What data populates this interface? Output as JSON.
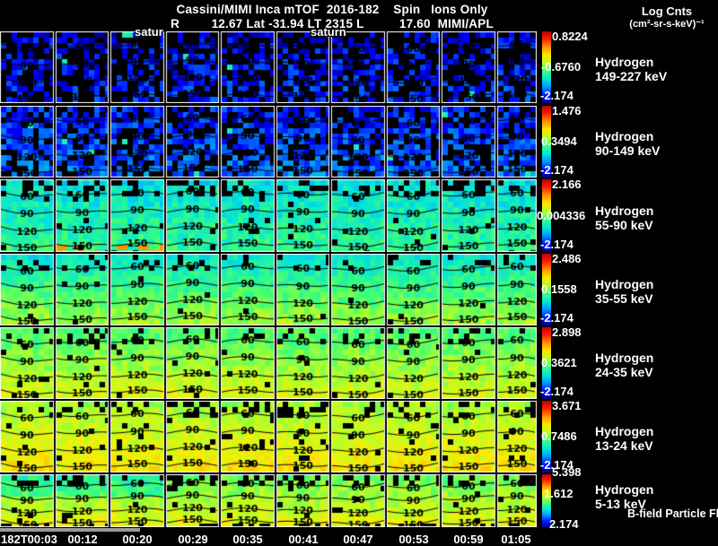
{
  "header": {
    "title_line1": "Cassini/MIMI Inca mTOF  2016-182    Spin   Ions Only",
    "title_line2": "R         12.67 Lat -31.94 LT 2315 L          17.60  MIMI/APL",
    "legend_title": "Log Cnts",
    "legend_units": "(cm²-sr-s-keV)⁻¹"
  },
  "overlay_labels": {
    "saturn_left": "satur",
    "saturn_right": "saturn",
    "bfield": "B-field Particle Flow"
  },
  "chart_data": {
    "type": "heatmap",
    "description": "Cassini MIMI INCA mTOF ion camera sky maps: 7 energy-band rows x 10 time-step columns, log counts rainbow scale, with magnetic pitch-angle contours",
    "panel_columns": 10,
    "time_ticks": [
      "182T00:03",
      "00:12",
      "00:20",
      "00:29",
      "00:35",
      "00:41",
      "00:47",
      "00:53",
      "00:59",
      "01:05"
    ],
    "contour_levels": [
      "60",
      "90",
      "120",
      "150"
    ],
    "colorbar_gradient": [
      "#be0000",
      "#ff2000",
      "#ff9600",
      "#ffe600",
      "#b4ff28",
      "#3cff82",
      "#00e6dc",
      "#0096ff",
      "#0014ff",
      "#000082"
    ],
    "rows": [
      {
        "species": "Hydrogen",
        "band": "149-227 keV",
        "cbar_max": "0.8224",
        "cbar_mid": "-0.6760",
        "cbar_min": "-2.174"
      },
      {
        "species": "Hydrogen",
        "band": "90-149 keV",
        "cbar_max": "1.476",
        "cbar_mid": "0.3494",
        "cbar_min": "-2.174"
      },
      {
        "species": "Hydrogen",
        "band": "55-90 keV",
        "cbar_max": "2.166",
        "cbar_mid": "0.004336",
        "cbar_min": "-2.174"
      },
      {
        "species": "Hydrogen",
        "band": "35-55 keV",
        "cbar_max": "2.486",
        "cbar_mid": "0.1558",
        "cbar_min": "-2.174"
      },
      {
        "species": "Hydrogen",
        "band": "24-35 keV",
        "cbar_max": "2.898",
        "cbar_mid": "0.3621",
        "cbar_min": "-2.174"
      },
      {
        "species": "Hydrogen",
        "band": "13-24 keV",
        "cbar_max": "3.671",
        "cbar_mid": "0.7486",
        "cbar_min": "-2.174"
      },
      {
        "species": "Hydrogen",
        "band": "5-13 keV",
        "cbar_max": "5.398",
        "cbar_mid": "1.612",
        "cbar_min": "2.174"
      }
    ]
  }
}
